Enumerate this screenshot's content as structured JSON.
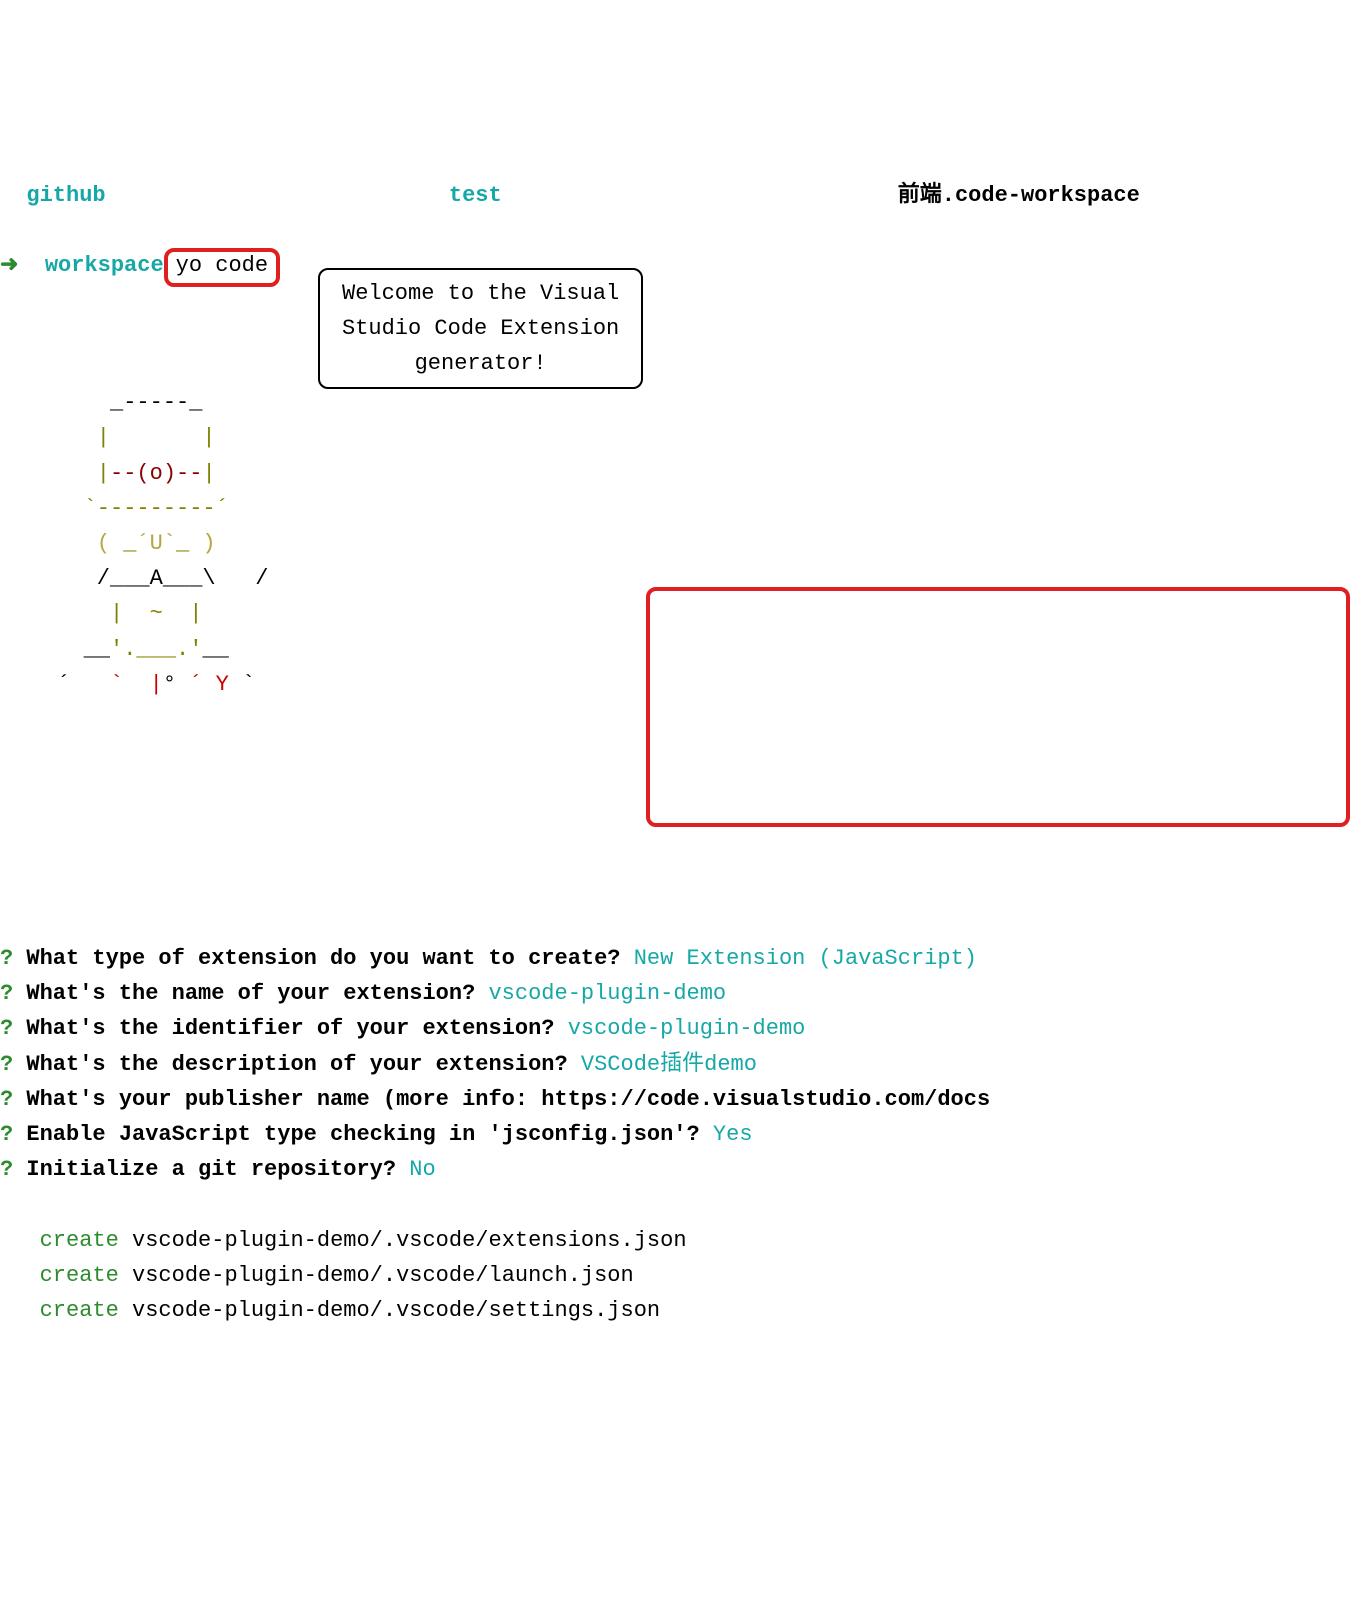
{
  "header": {
    "dir1": "github",
    "dir2": "test",
    "dir3": "前端.code-workspace",
    "arrow": "➜  ",
    "folder": "workspace",
    "command": "yo code"
  },
  "welcome": {
    "line1": "Welcome to the Visual",
    "line2": "Studio Code Extension",
    "line3": "generator!"
  },
  "ascii": {
    "l1": "     _-----_     ",
    "l2": "    |       |    ",
    "l3_a": "    |",
    "l3_b": "--(o)--",
    "l3_c": "|    ",
    "l4": "   `---------´   ",
    "l5_a": "    ",
    "l5_b": "( ",
    "l5_c": "_",
    "l5_d": "´U`",
    "l5_e": "_",
    "l5_f": " )",
    "l5_g": "    ",
    "l6": "    /___A___\\   /",
    "l7_a": "     ",
    "l7_b": "|  ~  |",
    "l7_c": "     ",
    "l8_a": "   __",
    "l8_b": "'.___.'",
    "l8_c": "__   ",
    "l9_a": " ´   ",
    "l9_b": "`  |",
    "l9_c": "° ",
    "l9_d": "´ Y",
    "l9_e": " ` "
  },
  "prompts": [
    {
      "q": "What type of extension do you want to create?",
      "a": "New Extension (JavaScript)"
    },
    {
      "q": "What's the name of your extension?",
      "a": "vscode-plugin-demo"
    },
    {
      "q": "What's the identifier of your extension?",
      "a": "vscode-plugin-demo"
    },
    {
      "q": "What's the description of your extension?",
      "a": "VSCode插件demo"
    },
    {
      "q": "What's your publisher name (more info: https://code.visualstudio.com/docs",
      "a": ""
    },
    {
      "q": "Enable JavaScript type checking in 'jsconfig.json'?",
      "a": "Yes"
    },
    {
      "q": "Initialize a git repository?",
      "a": "No"
    }
  ],
  "creates": [
    {
      "verb": "create",
      "path": "vscode-plugin-demo/.vscode/extensions.json"
    },
    {
      "verb": "create",
      "path": "vscode-plugin-demo/.vscode/launch.json"
    },
    {
      "verb": "create",
      "path": "vscode-plugin-demo/.vscode/settings.json"
    }
  ]
}
